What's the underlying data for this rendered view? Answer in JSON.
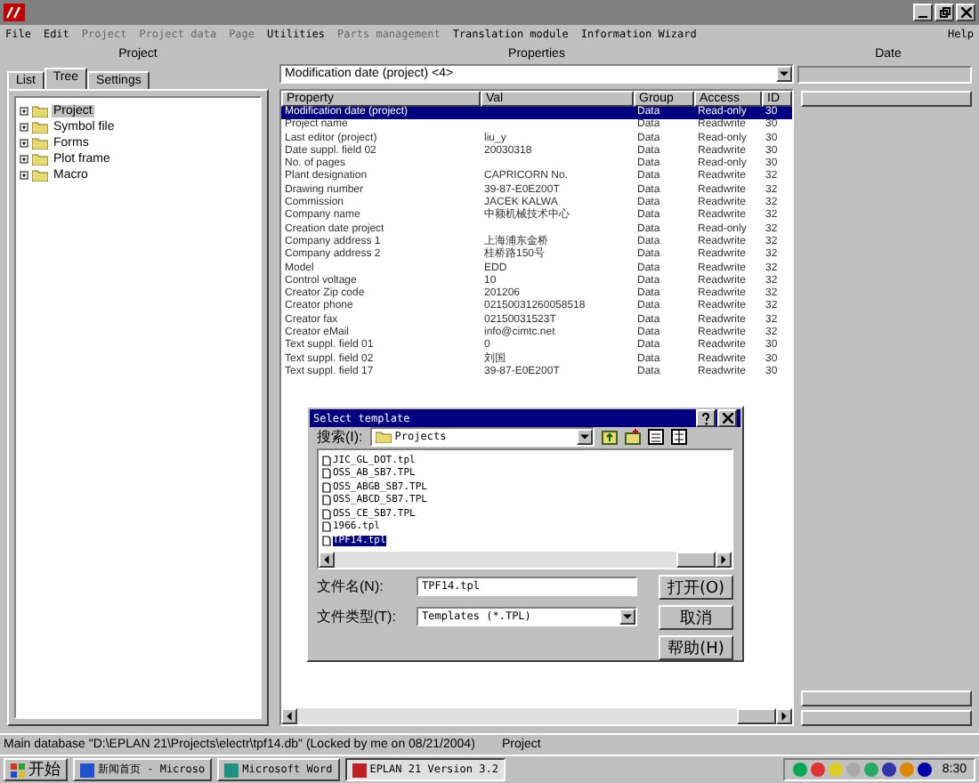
{
  "menu": [
    {
      "label": "File",
      "disabled": false
    },
    {
      "label": "Edit",
      "disabled": false
    },
    {
      "label": "Project",
      "disabled": true
    },
    {
      "label": "Project data",
      "disabled": true
    },
    {
      "label": "Page",
      "disabled": true
    },
    {
      "label": "Utilities",
      "disabled": false
    },
    {
      "label": "Parts management",
      "disabled": true
    },
    {
      "label": "Translation module",
      "disabled": false
    },
    {
      "label": "Information Wizard",
      "disabled": false
    },
    {
      "label": "Help",
      "disabled": false
    }
  ],
  "sections": [
    "Project",
    "Properties",
    "Date"
  ],
  "tabs": [
    {
      "label": "List",
      "selected": false
    },
    {
      "label": "Tree",
      "selected": true
    },
    {
      "label": "Settings",
      "selected": false
    }
  ],
  "tree": [
    {
      "label": "Project",
      "selected": true
    },
    {
      "label": "Symbol file",
      "selected": false
    },
    {
      "label": "Forms",
      "selected": false
    },
    {
      "label": "Plot frame",
      "selected": false
    },
    {
      "label": "Macro",
      "selected": false
    }
  ],
  "filter": {
    "value": "Modification date (project) <4>"
  },
  "table": {
    "columns": [
      "Property",
      "Val",
      "Group",
      "Access",
      "ID"
    ],
    "rows": [
      {
        "selected": true,
        "cells": [
          "Modification date (project)",
          "",
          "Data",
          "Read-only",
          "30"
        ]
      },
      {
        "selected": false,
        "cells": [
          "Project name",
          "",
          "Data",
          "Readwrite",
          "30"
        ]
      },
      {
        "selected": false,
        "cells": [
          "Last editor (project)",
          "liu_y",
          "Data",
          "Read-only",
          "30"
        ]
      },
      {
        "selected": false,
        "cells": [
          "Date suppl. field 02",
          "20030318",
          "Data",
          "Readwrite",
          "30"
        ]
      },
      {
        "selected": false,
        "cells": [
          "No. of pages",
          "",
          "Data",
          "Read-only",
          "30"
        ]
      },
      {
        "selected": false,
        "cells": [
          "Plant designation",
          "CAPRICORN No.",
          "Data",
          "Readwrite",
          "32"
        ]
      },
      {
        "selected": false,
        "cells": [
          "Drawing number",
          "39-87-E0E200T",
          "Data",
          "Readwrite",
          "32"
        ]
      },
      {
        "selected": false,
        "cells": [
          "Commission",
          "JACEK KALWA",
          "Data",
          "Readwrite",
          "32"
        ]
      },
      {
        "selected": false,
        "cells": [
          "Company name",
          "中额机械技术中心",
          "Data",
          "Readwrite",
          "32"
        ]
      },
      {
        "selected": false,
        "cells": [
          "Creation date project",
          "",
          "Data",
          "Read-only",
          "32"
        ]
      },
      {
        "selected": false,
        "cells": [
          "Company address 1",
          "上海浦东金桥",
          "Data",
          "Readwrite",
          "32"
        ]
      },
      {
        "selected": false,
        "cells": [
          "Company address 2",
          "桂桥路150号",
          "Data",
          "Readwrite",
          "32"
        ]
      },
      {
        "selected": false,
        "cells": [
          "Model",
          "EDD",
          "Data",
          "Readwrite",
          "32"
        ]
      },
      {
        "selected": false,
        "cells": [
          "Control voltage",
          "10",
          "Data",
          "Readwrite",
          "32"
        ]
      },
      {
        "selected": false,
        "cells": [
          "Creator Zip code",
          "201206",
          "Data",
          "Readwrite",
          "32"
        ]
      },
      {
        "selected": false,
        "cells": [
          "Creator phone",
          "02150031260058518",
          "Data",
          "Readwrite",
          "32"
        ]
      },
      {
        "selected": false,
        "cells": [
          "Creator fax",
          "02150031523T",
          "Data",
          "Readwrite",
          "32"
        ]
      },
      {
        "selected": false,
        "cells": [
          "Creator eMail",
          "info@cimtc.net",
          "Data",
          "Readwrite",
          "32"
        ]
      },
      {
        "selected": false,
        "cells": [
          "Text suppl. field 01",
          "0",
          "Data",
          "Readwrite",
          "30"
        ]
      },
      {
        "selected": false,
        "cells": [
          "Text suppl. field 02",
          "刘国",
          "Data",
          "Readwrite",
          "30"
        ]
      },
      {
        "selected": false,
        "cells": [
          "Text suppl. field 17",
          "39-87-E0E200T",
          "Data",
          "Readwrite",
          "30"
        ]
      }
    ]
  },
  "dialog": {
    "title": "Select template",
    "look_in_label": "搜索(I):",
    "look_in": "Projects",
    "files": [
      {
        "name": "JIC_GL_DOT.tpl",
        "selected": false
      },
      {
        "name": "OSS_AB_SB7.TPL",
        "selected": false
      },
      {
        "name": "OSS_ABGB_SB7.TPL",
        "selected": false
      },
      {
        "name": "OSS_ABCD_SB7.TPL",
        "selected": false
      },
      {
        "name": "OSS_CE_SB7.TPL",
        "selected": false
      },
      {
        "name": "1966.tpl",
        "selected": false
      },
      {
        "name": "TPF14.tpl",
        "selected": true
      }
    ],
    "filename_label": "文件名(N):",
    "filename": "TPF14.tpl",
    "filetype_label": "文件类型(T):",
    "filetype": "Templates (*.TPL)",
    "buttons": [
      "打开(O)",
      "取消",
      "帮助(H)"
    ]
  },
  "status_bar": [
    "Main database \"D:\\EPLAN 21\\Projects\\electr\\tpf14.db\" (Locked by me on 08/21/2004)",
    "Project"
  ],
  "taskbar": {
    "start": "开始",
    "tasks": [
      {
        "label": "新闻首页 - Microso",
        "selected": false
      },
      {
        "label": "Microsoft Word",
        "selected": false
      },
      {
        "label": "EPLAN 21 Version 3.2",
        "selected": true
      }
    ],
    "clock": "8:30"
  }
}
